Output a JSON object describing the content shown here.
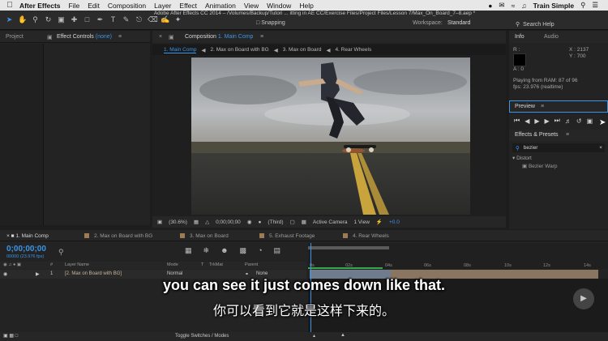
{
  "menubar": {
    "app_name": "After Effects",
    "menus": [
      "File",
      "Edit",
      "Composition",
      "Layer",
      "Effect",
      "Animation",
      "View",
      "Window",
      "Help"
    ],
    "user": "Train Simple"
  },
  "toolbar": {
    "document_title": "Adobe After Effects CC 2014 – /Volumes/Backup/Tutori ... itting in AE CC/Exercise Files/Project Files/Lesson 7/Max_On_Board_7–8.aep *",
    "snapping": "Snapping",
    "workspace_label": "Workspace:",
    "workspace_value": "Standard",
    "search_help": "Search Help"
  },
  "left_panel": {
    "tab_project": "Project",
    "tab_effect_controls": "Effect Controls",
    "effect_controls_target": "(none)"
  },
  "comp_panel": {
    "tab_label": "Composition",
    "tab_target": "1. Main Comp",
    "breadcrumbs": [
      "1. Main Comp",
      "2. Max on Board with BG",
      "3. Max on Board",
      "4. Rear Wheels"
    ],
    "footer": {
      "zoom": "(30.6%)",
      "timecode": "0;00;00;00",
      "resolution": "(Third)",
      "camera": "Active Camera",
      "views": "1 View",
      "exposure": "+0.0"
    }
  },
  "info_panel": {
    "tab_info": "Info",
    "tab_audio": "Audio",
    "r": "R :",
    "g": "G :",
    "b": "B :",
    "a": "A : 0",
    "x": "X : 2137",
    "y": "Y : 700",
    "playing_line1": "Playing from RAM: 87 of 96",
    "playing_line2": "fps: 23.976 (realtime)"
  },
  "preview_panel": {
    "tab": "Preview"
  },
  "effects_panel": {
    "tab": "Effects & Presets",
    "search_value": "bezier",
    "category": "Distort",
    "effect": "Bezier Warp"
  },
  "timeline": {
    "tabs": [
      "1. Main Comp",
      "2. Max on Board with BG",
      "3. Max on Board",
      "5. Exhaust Footage",
      "4. Rear Wheels"
    ],
    "timecode": "0;00;00;00",
    "fps": "00000 (23.976 fps)",
    "columns": {
      "num": "#",
      "layer_name": "Layer Name",
      "mode": "Mode",
      "t": "T",
      "trkmat": "TrkMat",
      "parent": "Parent"
    },
    "layer": {
      "num": "1",
      "name": "[2. Max on Board with BG]",
      "mode": "Normal",
      "parent": "None"
    },
    "ruler_labels": [
      "0s",
      "02s",
      "04s",
      "06s",
      "08s",
      "10s",
      "12s",
      "14s"
    ],
    "footer_toggle": "Toggle Switches / Modes"
  },
  "captions": {
    "english": "you can see it just comes down like that.",
    "chinese": "你可以看到它就是这样下来的。"
  },
  "colors": {
    "accent": "#3b95e8",
    "panel_bg": "#232323",
    "label_tan": "#9c7d53"
  }
}
